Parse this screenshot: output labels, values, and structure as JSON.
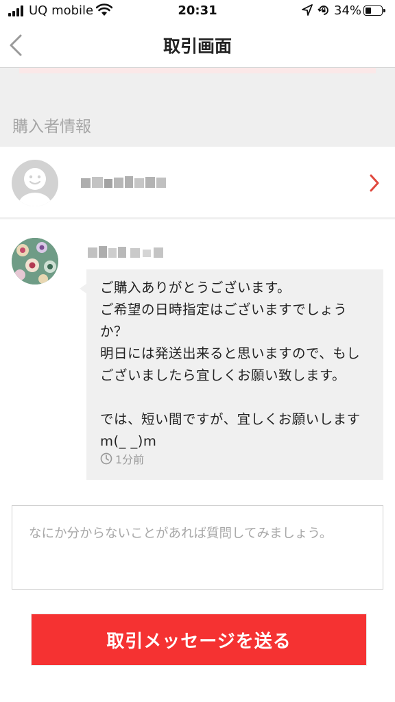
{
  "status_bar": {
    "carrier": "UQ mobile",
    "time": "20:31",
    "battery_percent": "34%",
    "icons": [
      "signal-icon",
      "wifi-icon",
      "location-arrow-icon",
      "rotation-lock-icon",
      "battery-icon"
    ]
  },
  "nav": {
    "title": "取引画面",
    "back_icon": "chevron-left-icon"
  },
  "buyer_section": {
    "heading": "購入者情報",
    "chevron_icon": "chevron-right-icon"
  },
  "message": {
    "text": "ご購入ありがとうございます。\nご希望の日時指定はございますでしょうか？\n明日には発送出来ると思いますので、もしございましたら宜しくお願い致します。\n\nでは、短い間ですが、宜しくお願いします m(_ _)m",
    "time": "1分前",
    "time_icon": "clock-icon"
  },
  "input": {
    "placeholder": "なにか分からないことがあれば質問してみましょう。",
    "value": ""
  },
  "send_button": {
    "label": "取引メッセージを送る"
  },
  "colors": {
    "accent": "#f53232",
    "chevron": "#e0483e",
    "background_band": "#efefef",
    "bubble": "#f0f0f0"
  }
}
